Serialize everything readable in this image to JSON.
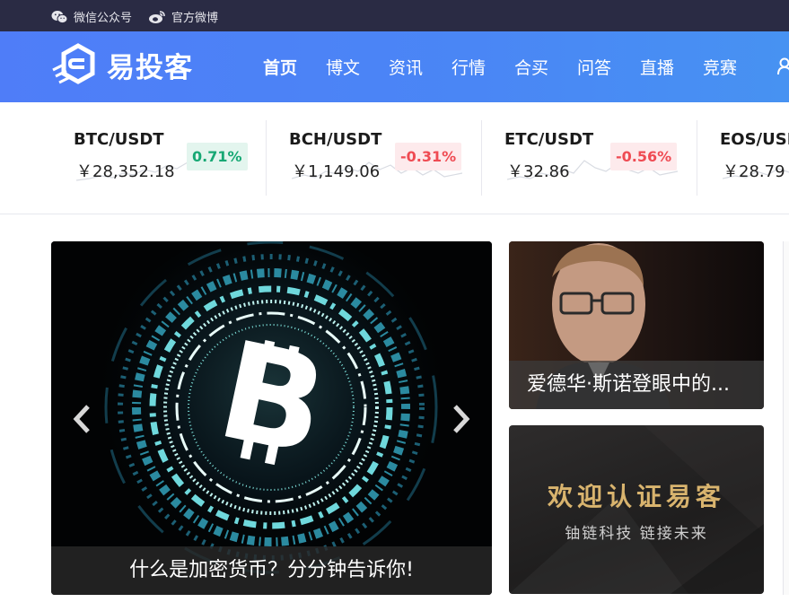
{
  "topbar": {
    "wechat_label": "微信公众号",
    "weibo_label": "官方微博"
  },
  "header": {
    "logo_text": "易投客",
    "nav": [
      "首页",
      "博文",
      "资讯",
      "行情",
      "合买",
      "问答",
      "直播",
      "竞赛"
    ],
    "active_nav": "首页"
  },
  "ticker": [
    {
      "pair": "BTC/USDT",
      "price": "￥28,352.18",
      "change": "0.71%",
      "direction": "up"
    },
    {
      "pair": "BCH/USDT",
      "price": "￥1,149.06",
      "change": "-0.31%",
      "direction": "down"
    },
    {
      "pair": "ETC/USDT",
      "price": "￥32.86",
      "change": "-0.56%",
      "direction": "down"
    },
    {
      "pair": "EOS/USDT",
      "price": "￥28.79",
      "change": "",
      "direction": ""
    }
  ],
  "carousel": {
    "caption": "什么是加密货币？分分钟告诉你!"
  },
  "side_cards": {
    "card1_caption": "爱德华·斯诺登眼中的...",
    "card2_title": "欢迎认证易客",
    "card2_subtitle": "铀链科技  链接未来"
  },
  "colors": {
    "topbar": "#2a2b44",
    "header": "#4a86f5",
    "up": "#17a874",
    "down": "#ef4b53",
    "gold": "#d9b46e"
  }
}
